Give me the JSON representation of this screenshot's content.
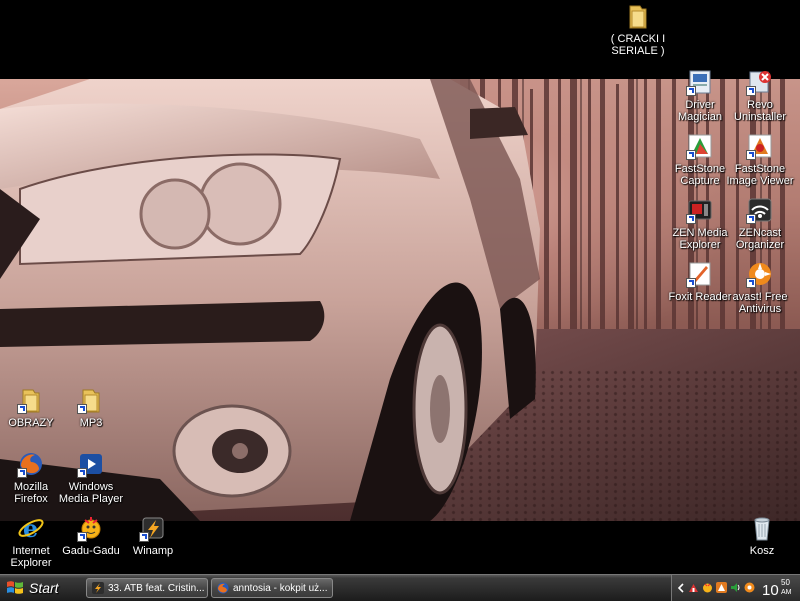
{
  "desktop": {
    "top_icons": [
      {
        "label": "( CRACKI I\nSERIALE )",
        "icon": "folder-icon"
      }
    ],
    "right_icons": [
      {
        "label": "Driver\nMagician",
        "icon": "driver-magician-icon"
      },
      {
        "label": "Revo\nUninstaller",
        "icon": "revo-uninstaller-icon"
      },
      {
        "label": "FastStone\nCapture",
        "icon": "faststone-capture-icon"
      },
      {
        "label": "FastStone\nImage Viewer",
        "icon": "faststone-image-viewer-icon"
      },
      {
        "label": "ZEN Media\nExplorer",
        "icon": "zen-media-explorer-icon"
      },
      {
        "label": "ZENcast\nOrganizer",
        "icon": "zencast-organizer-icon"
      },
      {
        "label": "Foxit Reader",
        "icon": "foxit-reader-icon"
      },
      {
        "label": "avast! Free\nAntivirus",
        "icon": "avast-icon"
      }
    ],
    "left_icons": [
      {
        "label": "OBRAZY",
        "icon": "folder-icon"
      },
      {
        "label": "MP3",
        "icon": "folder-icon"
      },
      {
        "label": "Mozilla\nFirefox",
        "icon": "firefox-icon"
      },
      {
        "label": "Windows\nMedia Player",
        "icon": "media-player-icon"
      },
      {
        "label": "Internet\nExplorer",
        "icon": "internet-explorer-icon"
      },
      {
        "label": "Gadu-Gadu",
        "icon": "gadu-gadu-icon"
      },
      {
        "label": "Winamp",
        "icon": "winamp-icon"
      }
    ],
    "recycle_bin": {
      "label": "Kosz",
      "icon": "recycle-bin-icon"
    }
  },
  "taskbar": {
    "start_label": "Start",
    "tasks": [
      {
        "label": "33. ATB feat. Cristin...",
        "icon": "winamp-icon"
      },
      {
        "label": "anntosia - kokpit uż...",
        "icon": "firefox-icon"
      }
    ],
    "tray": {
      "icons": [
        "chevron-left-icon",
        "network-icon",
        "gadu-gadu-icon",
        "faststone-icon",
        "speaker-icon",
        "avast-icon"
      ],
      "clock_hour": "10",
      "clock_minute": "50",
      "clock_ampm": "AM"
    }
  },
  "colors": {
    "taskbar": "#2a2a2a",
    "wallpaper_tint": "#b88277"
  }
}
